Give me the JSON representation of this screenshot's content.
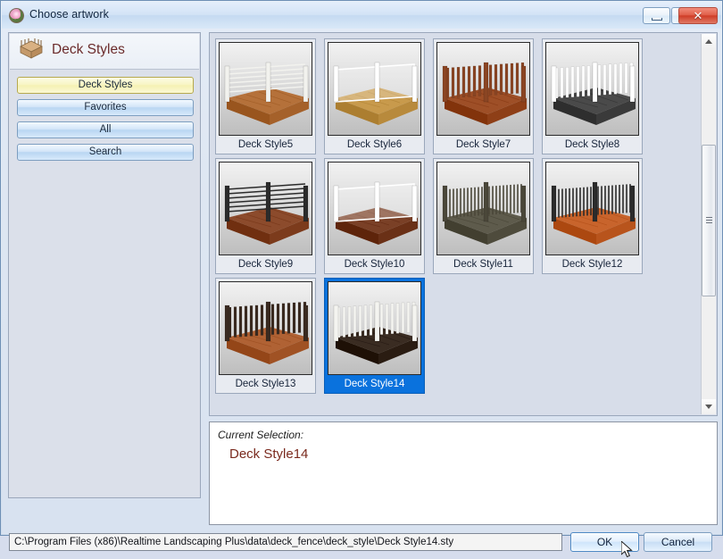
{
  "window": {
    "title": "Choose artwork",
    "icon": "app-flower-icon",
    "controls": {
      "minimize": "minimize-icon",
      "restore": "restore-icon",
      "close": "close-icon"
    }
  },
  "sidebar": {
    "icon": "deck-icon",
    "title": "Deck Styles",
    "buttons": [
      {
        "label": "Deck Styles",
        "active": true
      },
      {
        "label": "Favorites",
        "active": false
      },
      {
        "label": "All",
        "active": false
      },
      {
        "label": "Search",
        "active": false
      }
    ]
  },
  "gallery": {
    "items": [
      {
        "label": "Deck Style5",
        "selected": false,
        "deck_color": "#b5713a",
        "rail_color": "#f2f2ee",
        "rail_style": "cable"
      },
      {
        "label": "Deck Style6",
        "selected": false,
        "deck_color": "#c89a4c",
        "rail_color": "#ffffff",
        "rail_style": "glass"
      },
      {
        "label": "Deck Style7",
        "selected": false,
        "deck_color": "#9e4f27",
        "rail_color": "#8a4523",
        "rail_style": "picket"
      },
      {
        "label": "Deck Style8",
        "selected": false,
        "deck_color": "#4a4a4a",
        "rail_color": "#ffffff",
        "rail_style": "picket"
      },
      {
        "label": "Deck Style9",
        "selected": false,
        "deck_color": "#8c4b2c",
        "rail_color": "#2b2b2b",
        "rail_style": "cable"
      },
      {
        "label": "Deck Style10",
        "selected": false,
        "deck_color": "#7a4026",
        "rail_color": "#ffffff",
        "rail_style": "glass"
      },
      {
        "label": "Deck Style11",
        "selected": false,
        "deck_color": "#5e5b4c",
        "rail_color": "#4a4739",
        "rail_style": "baluster"
      },
      {
        "label": "Deck Style12",
        "selected": false,
        "deck_color": "#c8642c",
        "rail_color": "#2b2b2b",
        "rail_style": "baluster"
      },
      {
        "label": "Deck Style13",
        "selected": false,
        "deck_color": "#b06234",
        "rail_color": "#3a2a20",
        "rail_style": "picket"
      },
      {
        "label": "Deck Style14",
        "selected": true,
        "deck_color": "#3a2c22",
        "rail_color": "#f4f4f0",
        "rail_style": "picket"
      }
    ],
    "columns": 4,
    "scrollbar": {
      "position": "right",
      "thumb_visible": true
    }
  },
  "selection": {
    "label": "Current Selection:",
    "value": "Deck Style14"
  },
  "footer": {
    "path": "C:\\Program Files (x86)\\Realtime Landscaping Plus\\data\\deck_fence\\deck_style\\Deck Style14.sty",
    "ok_label": "OK",
    "cancel_label": "Cancel"
  },
  "colors": {
    "selection_blue": "#0a72dd",
    "active_button_yellow": "#f8f5c5",
    "title_maroon": "#6b2b2b",
    "selection_value_red": "#7a2a1e",
    "close_red": "#cf3d27"
  }
}
